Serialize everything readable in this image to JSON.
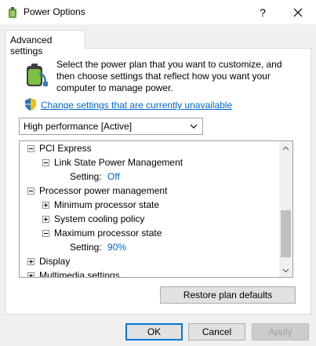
{
  "window": {
    "title": "Power Options",
    "help_glyph": "?",
    "close_icon": "close-icon"
  },
  "tab": {
    "label": "Advanced settings"
  },
  "description": "Select the power plan that you want to customize, and then choose settings that reflect how you want your computer to manage power.",
  "change_link": "Change settings that are currently unavailable",
  "plan_select": {
    "value": "High performance [Active]"
  },
  "tree": {
    "rows": [
      {
        "label": "PCI Express",
        "expander": "minus"
      },
      {
        "label": "Link State Power Management",
        "expander": "minus"
      },
      {
        "label": "Setting:",
        "value": "Off"
      },
      {
        "label": "Processor power management",
        "expander": "minus"
      },
      {
        "label": "Minimum processor state",
        "expander": "plus"
      },
      {
        "label": "System cooling policy",
        "expander": "plus"
      },
      {
        "label": "Maximum processor state",
        "expander": "minus"
      },
      {
        "label": "Setting:",
        "value": "90%"
      },
      {
        "label": "Display",
        "expander": "plus"
      },
      {
        "label": "Multimedia settings",
        "expander": "plus"
      }
    ]
  },
  "buttons": {
    "restore": "Restore plan defaults",
    "ok": "OK",
    "cancel": "Cancel",
    "apply": "Apply"
  },
  "colors": {
    "link": "#0066cc",
    "accent": "#0078d7"
  }
}
